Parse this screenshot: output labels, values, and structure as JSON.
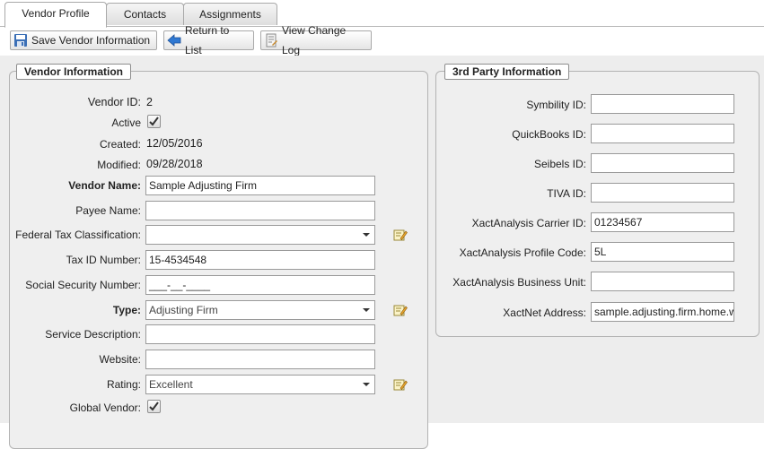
{
  "tabs": [
    {
      "label": "Vendor Profile",
      "active": true
    },
    {
      "label": "Contacts",
      "active": false
    },
    {
      "label": "Assignments",
      "active": false
    }
  ],
  "toolbar": {
    "save_label": "Save Vendor Information",
    "return_label": "Return to List",
    "changelog_label": "View Change Log"
  },
  "vendor_info": {
    "title": "Vendor Information",
    "vendor_id_label": "Vendor ID:",
    "vendor_id": "2",
    "active_label": "Active",
    "active": true,
    "created_label": "Created:",
    "created": "12/05/2016",
    "modified_label": "Modified:",
    "modified": "09/28/2018",
    "vendor_name_label": "Vendor Name:",
    "vendor_name": "Sample Adjusting Firm",
    "payee_name_label": "Payee Name:",
    "payee_name": "",
    "tax_class_label": "Federal Tax Classification:",
    "tax_class": "",
    "tax_id_label": "Tax ID Number:",
    "tax_id": "15-4534548",
    "ssn_label": "Social Security Number:",
    "ssn": "___-__-____",
    "type_label": "Type:",
    "type": "Adjusting Firm",
    "service_desc_label": "Service Description:",
    "service_desc": "",
    "website_label": "Website:",
    "website": "",
    "rating_label": "Rating:",
    "rating": "Excellent",
    "global_vendor_label": "Global Vendor:",
    "global_vendor": true
  },
  "third_party": {
    "title": "3rd Party Information",
    "symbility_label": "Symbility ID:",
    "symbility": "",
    "quickbooks_label": "QuickBooks ID:",
    "quickbooks": "",
    "seibels_label": "Seibels ID:",
    "seibels": "",
    "tiva_label": "TIVA ID:",
    "tiva": "",
    "xact_carrier_label": "XactAnalysis Carrier ID:",
    "xact_carrier": "01234567",
    "xact_profile_label": "XactAnalysis Profile Code:",
    "xact_profile": "5L",
    "xact_business_label": "XactAnalysis Business Unit:",
    "xact_business": "",
    "xactnet_label": "XactNet Address:",
    "xactnet": "sample.adjusting.firm.home.w"
  },
  "icons": {
    "save": "save-icon",
    "return": "arrow-left-icon",
    "changelog": "change-log-icon",
    "edit": "edit-list-icon"
  },
  "colors": {
    "accent_blue": "#2b6cc4",
    "panel_bg": "#efefef"
  }
}
